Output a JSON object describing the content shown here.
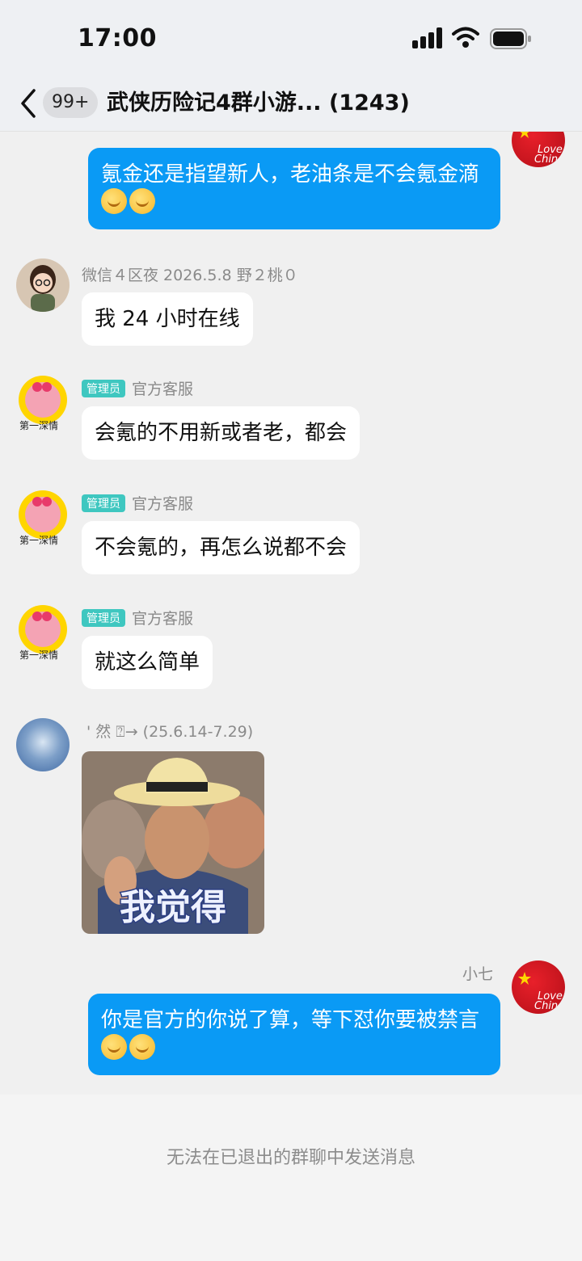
{
  "status_bar": {
    "time": "17:00"
  },
  "nav": {
    "back_icon": "chevron-left-icon",
    "unread_badge": "99+",
    "title": "武侠历险记4群小游... (1243)"
  },
  "messages": [
    {
      "side": "right",
      "text": "氪金还是指望新人，老油条是不会氪金滴",
      "emoji_count": 2,
      "avatar": "china-flag-love-avatar"
    },
    {
      "side": "left",
      "sender": "微信４区夜 2026.5.8 野２桃０",
      "text": "我 24 小时在线",
      "avatar": "cartoon-girl-avatar"
    },
    {
      "side": "left",
      "tag": "管理员",
      "sender": "官方客服",
      "text": "会氪的不用新或者老，都会",
      "avatar": "pink-pig-avatar"
    },
    {
      "side": "left",
      "tag": "管理员",
      "sender": "官方客服",
      "text": "不会氪的，再怎么说都不会",
      "avatar": "pink-pig-avatar"
    },
    {
      "side": "left",
      "tag": "管理员",
      "sender": "官方客服",
      "text": "就这么简单",
      "avatar": "pink-pig-avatar"
    },
    {
      "side": "left",
      "sender": "' 然 ⍰→ (25.6.14-7.29)",
      "sticker_caption": "我觉得",
      "avatar": "sky-avatar"
    },
    {
      "side": "right",
      "sender": "小七",
      "text": "你是官方的你说了算，等下怼你要被禁言",
      "emoji_count": 2,
      "avatar": "china-flag-love-avatar"
    }
  ],
  "avatar_text": {
    "love": "Love",
    "china": "Chin"
  },
  "pig_caption": "第一深情",
  "bottom_notice": "无法在已退出的群聊中发送消息",
  "colors": {
    "outgoing_bubble": "#0a9af5",
    "admin_tag": "#3fc7c0",
    "background": "#f0f0f0"
  }
}
